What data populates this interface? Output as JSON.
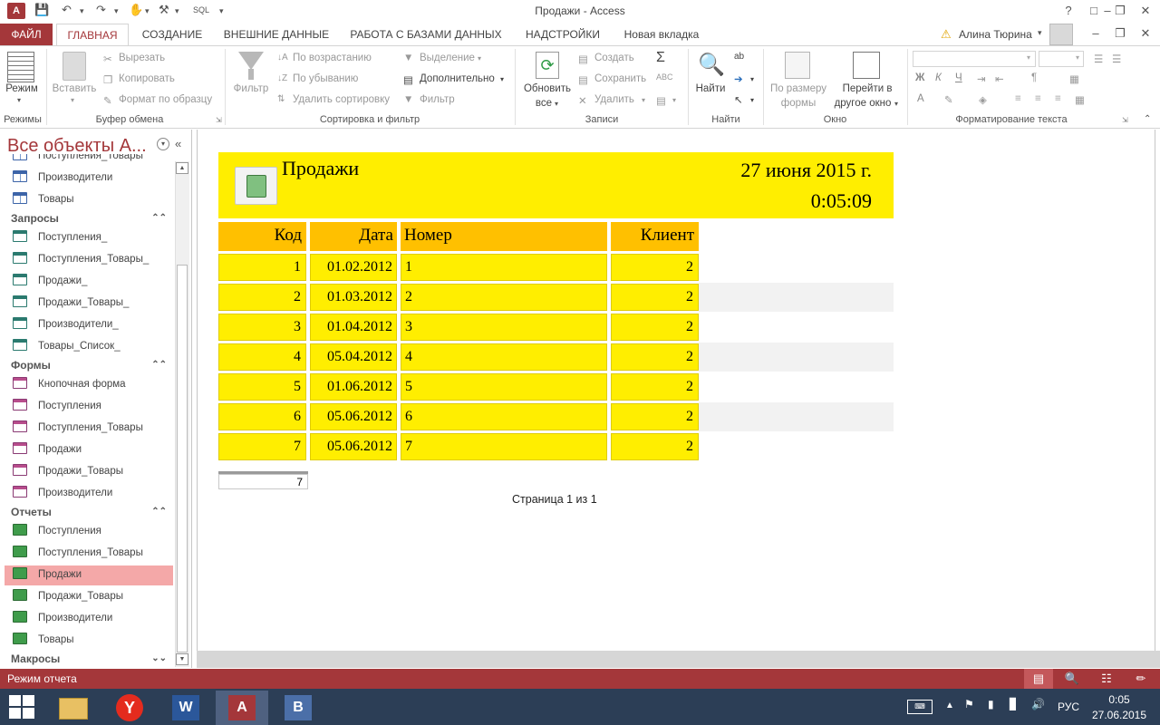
{
  "window": {
    "title": "Продажи - Access",
    "qat_sql": "SQL",
    "help": "?",
    "user": "Алина Тюрина"
  },
  "tabs": [
    {
      "label": "ФАЙЛ"
    },
    {
      "label": "ГЛАВНАЯ"
    },
    {
      "label": "СОЗДАНИЕ"
    },
    {
      "label": "ВНЕШНИЕ ДАННЫЕ"
    },
    {
      "label": "РАБОТА С БАЗАМИ ДАННЫХ"
    },
    {
      "label": "НАДСТРОЙКИ"
    },
    {
      "label": "Новая вкладка"
    }
  ],
  "ribbon": {
    "groups": {
      "modes": "Режимы",
      "clipboard": "Буфер обмена",
      "sort_filter": "Сортировка и фильтр",
      "records": "Записи",
      "find": "Найти",
      "window": "Окно",
      "text_format": "Форматирование текста"
    },
    "mode": "Режим",
    "paste": "Вставить",
    "cut": "Вырезать",
    "copy": "Копировать",
    "format_painter": "Формат по образцу",
    "filter": "Фильтр",
    "ascending": "По возрастанию",
    "descending": "По убыванию",
    "remove_sort": "Удалить сортировку",
    "selection": "Выделение",
    "advanced": "Дополнительно",
    "toggle_filter": "Фильтр",
    "refresh_1": "Обновить",
    "refresh_2": "все",
    "new": "Создать",
    "save": "Сохранить",
    "delete": "Удалить",
    "find": "Найти",
    "fit_1": "По размеру",
    "fit_2": "формы",
    "switch_1": "Перейти в",
    "switch_2": "другое окно",
    "bold": "Ж",
    "italic": "К",
    "underline": "Ч",
    "font_color": "А"
  },
  "nav": {
    "title": "Все объекты A...",
    "partial_item": "Поступления_Товары",
    "tables": [
      {
        "label": "Производители"
      },
      {
        "label": "Товары"
      }
    ],
    "sections": {
      "queries": "Запросы",
      "forms": "Формы",
      "reports": "Отчеты",
      "macros": "Макросы"
    },
    "queries": [
      {
        "label": "Поступления_"
      },
      {
        "label": "Поступления_Товары_"
      },
      {
        "label": "Продажи_"
      },
      {
        "label": "Продажи_Товары_"
      },
      {
        "label": "Производители_"
      },
      {
        "label": "Товары_Список_"
      }
    ],
    "forms": [
      {
        "label": "Кнопочная форма"
      },
      {
        "label": "Поступления"
      },
      {
        "label": "Поступления_Товары"
      },
      {
        "label": "Продажи"
      },
      {
        "label": "Продажи_Товары"
      },
      {
        "label": "Производители"
      }
    ],
    "reports": [
      {
        "label": "Поступления"
      },
      {
        "label": "Поступления_Товары"
      },
      {
        "label": "Продажи"
      },
      {
        "label": "Продажи_Товары"
      },
      {
        "label": "Производители"
      },
      {
        "label": "Товары"
      }
    ]
  },
  "report": {
    "title": "Продажи",
    "date": "27 июня 2015 г.",
    "time": "0:05:09",
    "headers": {
      "code": "Код",
      "date": "Дата",
      "number": "Номер",
      "client": "Клиент"
    },
    "rows": [
      {
        "code": "1",
        "date": "01.02.2012",
        "number": "1",
        "client": "2"
      },
      {
        "code": "2",
        "date": "01.03.2012",
        "number": "2",
        "client": "2"
      },
      {
        "code": "3",
        "date": "01.04.2012",
        "number": "3",
        "client": "2"
      },
      {
        "code": "4",
        "date": "05.04.2012",
        "number": "4",
        "client": "2"
      },
      {
        "code": "5",
        "date": "01.06.2012",
        "number": "5",
        "client": "2"
      },
      {
        "code": "6",
        "date": "05.06.2012",
        "number": "6",
        "client": "2"
      },
      {
        "code": "7",
        "date": "05.06.2012",
        "number": "7",
        "client": "2"
      }
    ],
    "total": "7",
    "page_footer": "Страница 1 из 1"
  },
  "status": {
    "text": "Режим отчета"
  },
  "taskbar": {
    "lang": "РУС",
    "time": "0:05",
    "date": "27.06.2015",
    "word_letter": "W",
    "access_letter": "A",
    "b_letter": "B"
  },
  "colors": {
    "access_red": "#a4373a",
    "report_yellow": "#ffee00",
    "header_orange": "#ffc000",
    "selected_nav": "#f4a8a8",
    "taskbar": "#2c3e56"
  }
}
